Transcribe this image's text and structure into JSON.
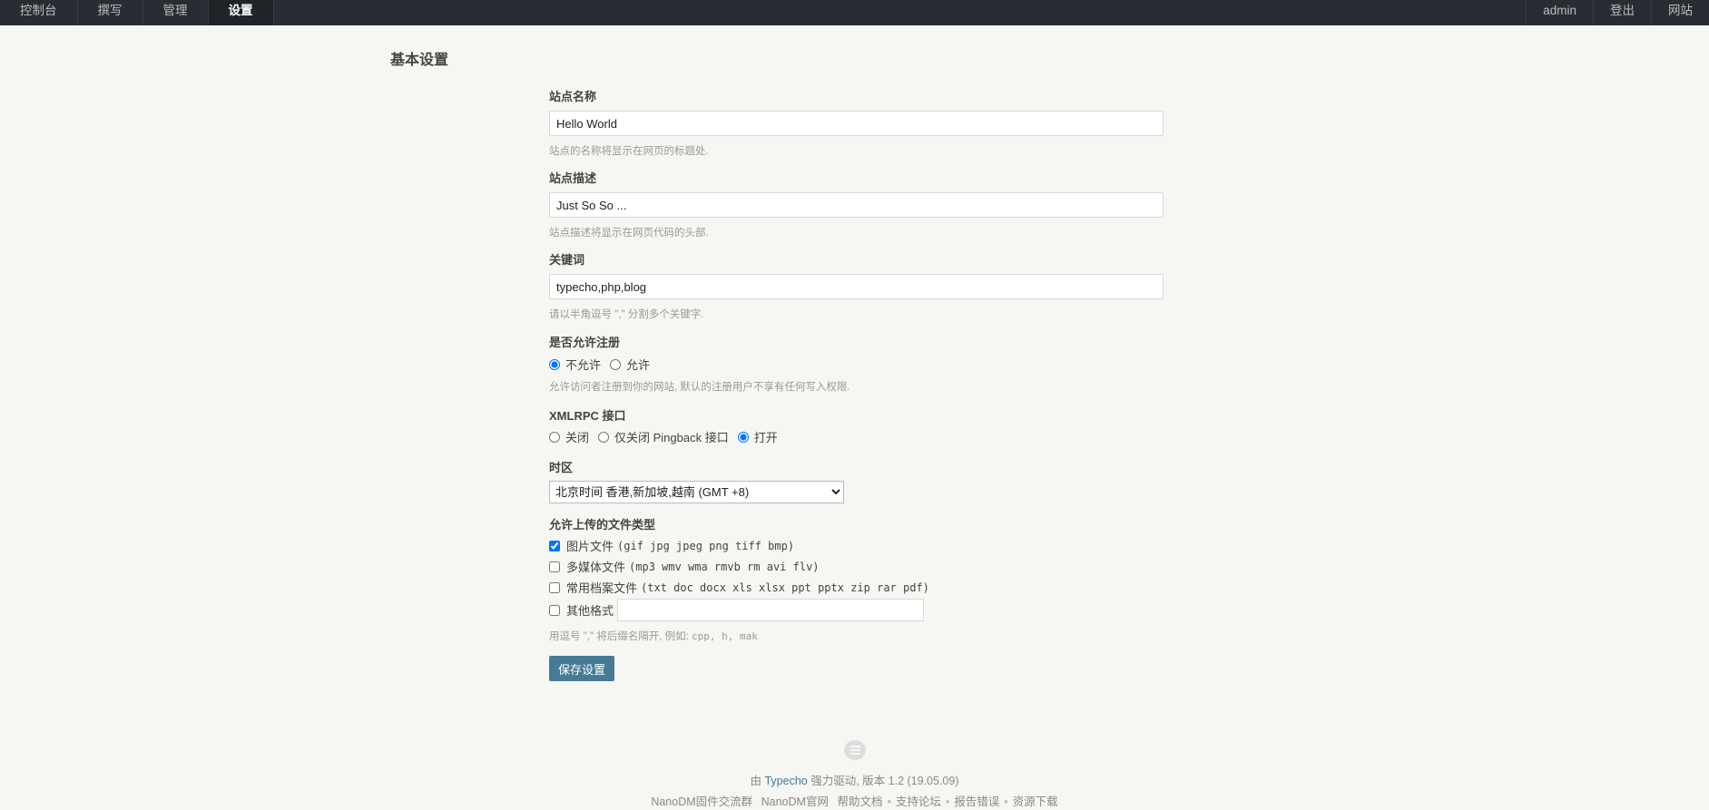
{
  "nav": {
    "left": [
      "控制台",
      "撰写",
      "管理",
      "设置"
    ],
    "right": [
      "admin",
      "登出",
      "网站"
    ],
    "active": "设置"
  },
  "page_title": "基本设置",
  "site_name": {
    "label": "站点名称",
    "value": "Hello World",
    "desc": "站点的名称将显示在网页的标题处."
  },
  "site_desc": {
    "label": "站点描述",
    "value": "Just So So ...",
    "desc": "站点描述将显示在网页代码的头部."
  },
  "keywords": {
    "label": "关键词",
    "value": "typecho,php,blog",
    "desc": "请以半角逗号 \",\" 分割多个关键字."
  },
  "register": {
    "label": "是否允许注册",
    "options": [
      "不允许",
      "允许"
    ],
    "selected": "不允许",
    "desc": "允许访问者注册到你的网站, 默认的注册用户不享有任何写入权限."
  },
  "xmlrpc": {
    "label": "XMLRPC 接口",
    "options": [
      "关闭",
      "仅关闭 Pingback 接口",
      "打开"
    ],
    "selected": "打开"
  },
  "timezone": {
    "label": "时区",
    "selected": "北京时间 香港,新加坡,越南 (GMT +8)"
  },
  "upload": {
    "label": "允许上传的文件类型",
    "items": [
      {
        "label": "图片文件",
        "exts": "(gif jpg jpeg png tiff bmp)",
        "checked": true
      },
      {
        "label": "多媒体文件",
        "exts": "(mp3 wmv wma rmvb rm avi flv)",
        "checked": false
      },
      {
        "label": "常用档案文件",
        "exts": "(txt doc docx xls xlsx ppt pptx zip rar pdf)",
        "checked": false
      }
    ],
    "other_label": "其他格式",
    "other_value": "",
    "desc_prefix": "用逗号 \",\" 将后缀名隔开, 例如: ",
    "desc_example": "cpp, h, mak"
  },
  "save_label": "保存设置",
  "footer": {
    "line1_prefix": "由",
    "brand": "Typecho",
    "line1_suffix": "强力驱动, 版本 1.2 (19.05.09)",
    "links": [
      "NanoDM固件交流群",
      "NanoDM官网",
      "帮助文档",
      "支持论坛",
      "报告错误",
      "资源下载"
    ]
  },
  "colors": {
    "nav_bg": "#292d33",
    "accent": "#467b96",
    "page_bg": "#f6f6f3"
  }
}
